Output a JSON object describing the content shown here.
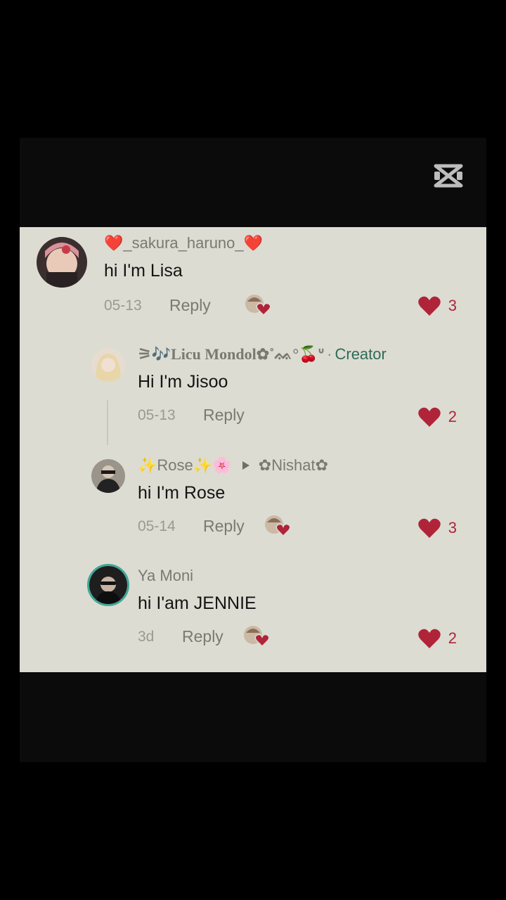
{
  "comments": [
    {
      "username": "❤️_sakura_haruno_❤️",
      "text": "hi I'm Lisa",
      "date": "05-13",
      "reply_label": "Reply",
      "likes": "3",
      "creator_liked": true
    },
    {
      "username": "⚞🎶Licu Mondol✿˚ᨐ°🍒ᐡ",
      "creator_tag": "Creator",
      "text": "Hi I'm Jisoo",
      "date": "05-13",
      "reply_label": "Reply",
      "likes": "2",
      "creator_liked": false
    },
    {
      "username": "✨Rose✨🌸",
      "reply_to": "✿Nishat✿",
      "text": "hi I'm Rose",
      "date": "05-14",
      "reply_label": "Reply",
      "likes": "3",
      "creator_liked": true
    },
    {
      "username": "Ya Moni",
      "text": "hi I'am JENNIE",
      "date": "3d",
      "reply_label": "Reply",
      "likes": "2",
      "creator_liked": true
    }
  ],
  "colors": {
    "panel_bg": "#dcdcd2",
    "heart": "#b0243a",
    "creator": "#2f6b57"
  },
  "icons": [
    "capcut-logo-icon",
    "heart-icon",
    "creator-liked-icon",
    "play-triangle-icon"
  ]
}
